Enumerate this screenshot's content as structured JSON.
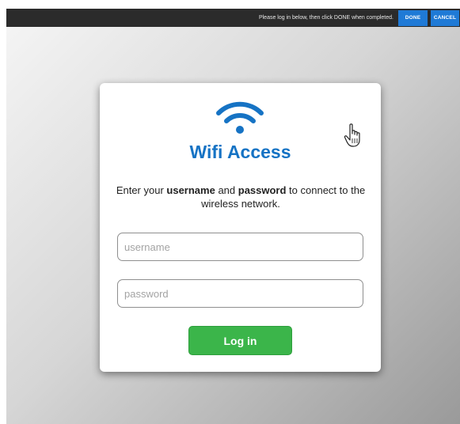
{
  "topbar": {
    "message": "Please log in below, then click DONE when completed.",
    "done_label": "DONE",
    "cancel_label": "CANCEL"
  },
  "card": {
    "icon": "wifi-icon",
    "title": "Wifi Access",
    "instructions": {
      "part1": "Enter your ",
      "username_word": "username",
      "part2": " and ",
      "password_word": "password",
      "part3": " to connect to the wireless network."
    },
    "username_placeholder": "username",
    "password_placeholder": "password",
    "username_value": "",
    "password_value": "",
    "login_label": "Log in"
  },
  "cursor_icon": "hand-pointer-icon",
  "colors": {
    "accent": "#1673c4",
    "button_blue": "#1f7ad6",
    "login_green": "#3bb54a",
    "topbar_bg": "#2b2b2b"
  }
}
